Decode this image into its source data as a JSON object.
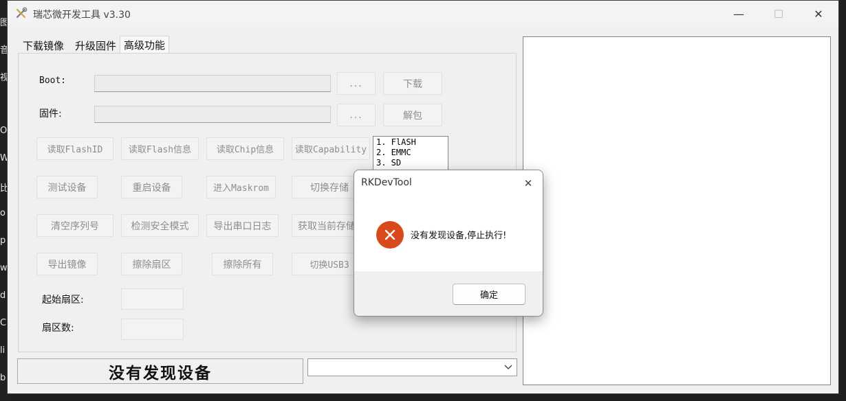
{
  "background_app": {
    "fragments": [
      "图/",
      "音",
      "视",
      "Or",
      "W",
      "比",
      "o",
      "p",
      "w",
      "d",
      "C",
      "li",
      "b"
    ]
  },
  "window": {
    "title": "瑞芯微开发工具 v3.30",
    "controls": {
      "minimize": "—",
      "maximize": "☐",
      "close": "✕"
    }
  },
  "tabs": [
    {
      "label": "下载镜像"
    },
    {
      "label": "升级固件"
    },
    {
      "label": "高级功能",
      "active": true
    }
  ],
  "advanced": {
    "boot_label": "Boot:",
    "boot_value": "",
    "boot_browse": "...",
    "boot_download": "下载",
    "firmware_label": "固件:",
    "firmware_value": "",
    "firmware_browse": "...",
    "firmware_unpack": "解包",
    "buttons": {
      "read_flash_id": "读取FlashID",
      "read_flash_info": "读取Flash信息",
      "read_chip_info": "读取Chip信息",
      "read_capability": "读取Capability",
      "test_device": "测试设备",
      "reboot_device": "重启设备",
      "enter_maskrom": "进入Maskrom",
      "switch_storage": "切换存储",
      "clear_serial": "清空序列号",
      "check_secure_mode": "检测安全模式",
      "export_serial_log": "导出串口日志",
      "get_current_storage": "获取当前存储",
      "export_image": "导出镜像",
      "erase_sector": "擦除扇区",
      "erase_all": "擦除所有",
      "switch_usb3": "切换USB3"
    },
    "storage_list": [
      "1. FlASH",
      "2. EMMC",
      "3. SD"
    ],
    "start_sector_label": "起始扇区:",
    "start_sector_value": "",
    "sector_count_label": "扇区数:",
    "sector_count_value": ""
  },
  "status": {
    "text": "没有发现设备",
    "combo_value": ""
  },
  "dialog": {
    "title": "RKDevTool",
    "message": "没有发现设备,停止执行!",
    "ok_label": "确定",
    "close": "✕",
    "icon": "error-icon"
  },
  "colors": {
    "error_red": "#d84a1b",
    "disabled_text": "#8e8e8e",
    "window_bg": "#f0f0f0"
  }
}
